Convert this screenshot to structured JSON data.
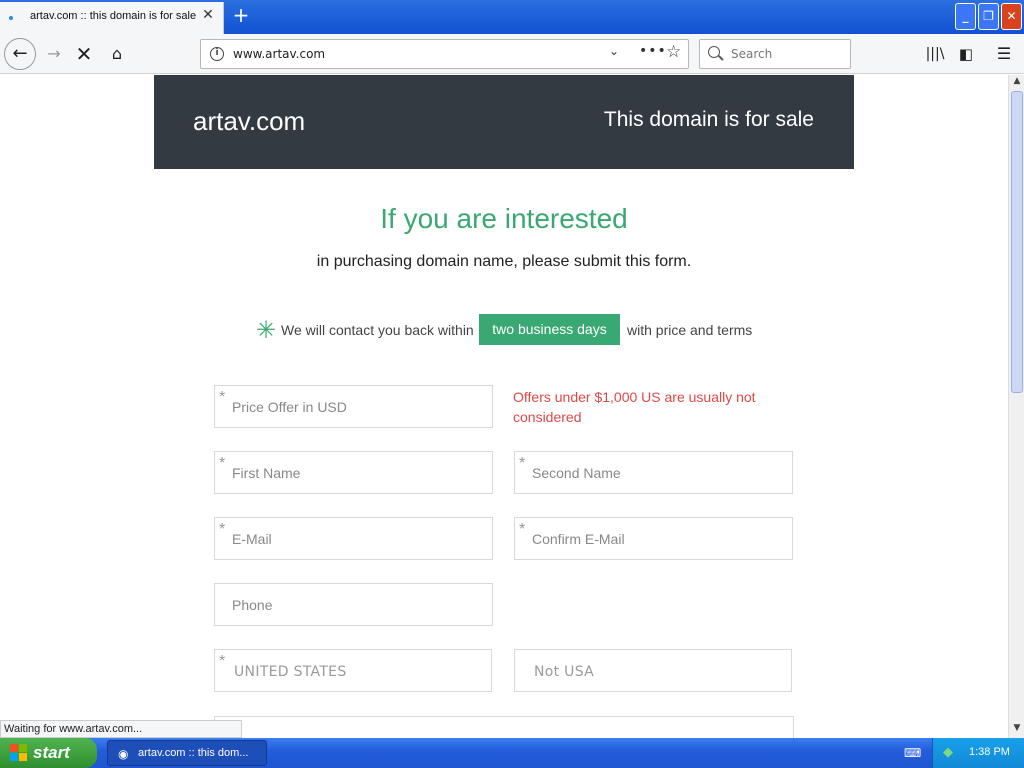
{
  "browser": {
    "tab_title": "artav.com :: this domain is for sale",
    "tab_close": "✕",
    "new_tab": "+",
    "url": "www.artav.com",
    "search_placeholder": "Search",
    "status_text": "Waiting for www.artav.com..."
  },
  "page": {
    "logo": "artav.com",
    "sale_text": "This domain is for sale",
    "headline": "If you are interested",
    "subline": "in purchasing domain name, please submit this form.",
    "contact_pre": "We will contact you back within",
    "contact_badge": "two business days",
    "contact_post": "with price and terms",
    "warning": "Offers under $1,000 US are usually not considered",
    "form": {
      "price_placeholder": "Price Offer in USD",
      "first_name_placeholder": "First Name",
      "second_name_placeholder": "Second Name",
      "email_placeholder": "E-Mail",
      "confirm_email_placeholder": "Confirm E-Mail",
      "phone_placeholder": "Phone",
      "country_value": "UNITED STATES",
      "state_value": "Not USA"
    }
  },
  "taskbar": {
    "start_label": "start",
    "task_label": "artav.com :: this dom...",
    "clock": "1:38 PM"
  },
  "colors": {
    "accent_green": "#3aa872",
    "header_dark": "#333a42",
    "warning_red": "#e04848"
  }
}
